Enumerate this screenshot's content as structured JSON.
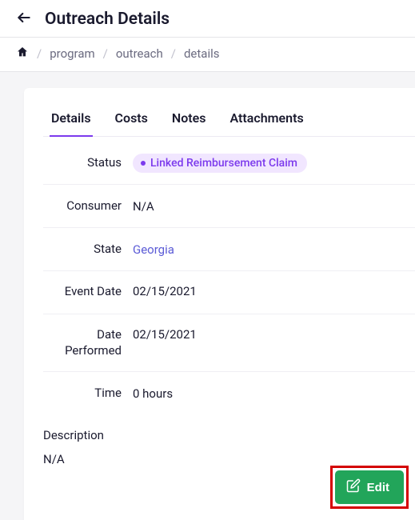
{
  "header": {
    "title": "Outreach Details"
  },
  "breadcrumb": {
    "items": [
      "program",
      "outreach",
      "details"
    ]
  },
  "tabs": [
    {
      "label": "Details",
      "active": true
    },
    {
      "label": "Costs",
      "active": false
    },
    {
      "label": "Notes",
      "active": false
    },
    {
      "label": "Attachments",
      "active": false
    }
  ],
  "details": {
    "status_label": "Status",
    "status_badge": "Linked Reimbursement Claim",
    "consumer_label": "Consumer",
    "consumer_value": "N/A",
    "state_label": "State",
    "state_value": "Georgia",
    "event_date_label": "Event Date",
    "event_date_value": "02/15/2021",
    "date_performed_label": "Date Performed",
    "date_performed_value": "02/15/2021",
    "time_label": "Time",
    "time_value": "0 hours",
    "description_label": "Description",
    "description_value": "N/A"
  },
  "actions": {
    "edit_label": "Edit"
  }
}
